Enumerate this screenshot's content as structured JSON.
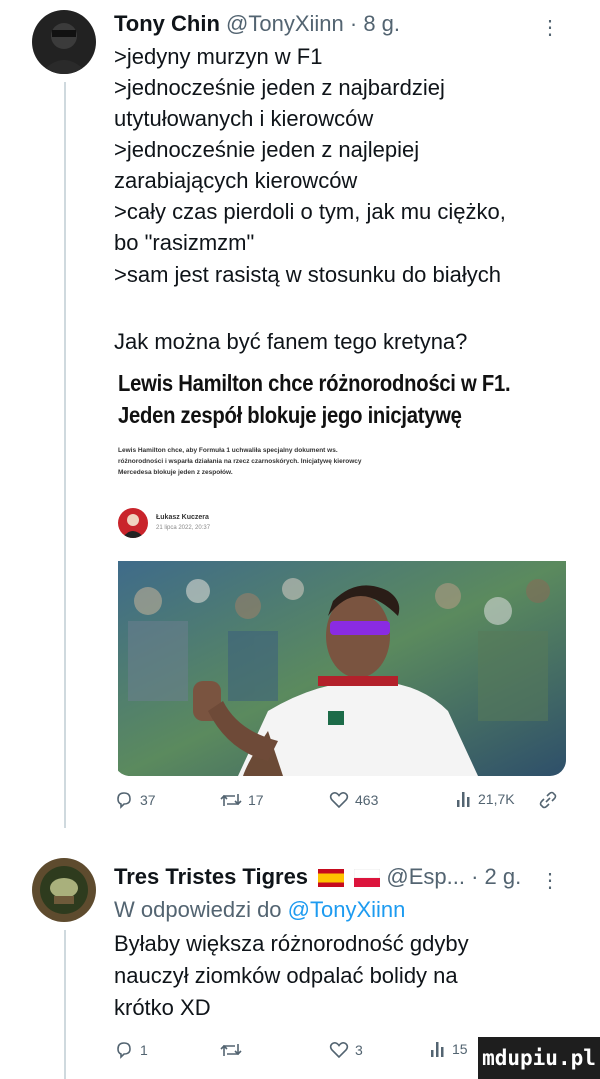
{
  "tweet1": {
    "name": "Tony Chin",
    "handle": "@TonyXiinn · 8 g.",
    "more": "⋮",
    "lines": [
      ">jedyny murzyn w F1",
      ">jednocześnie jeden z najbardziej",
      "utytułowanych i kierowców",
      ">jednocześnie jeden z najlepiej",
      "zarabiających kierowców",
      ">cały czas pierdoli o tym, jak mu ciężko,",
      "bo \"rasizmzm\"",
      ">sam jest rasistą w stosunku do białych",
      "Jak można być fanem tego kretyna?"
    ],
    "card": {
      "title_line1": "Lewis Hamilton chce różnorodności w F1.",
      "title_line2": "Jeden zespół blokuje jego inicjatywę",
      "lead_lines": [
        "Lewis Hamilton chce, aby Formuła 1 uchwaliła specjalny dokument ws.",
        "różnorodności i wsparła działania na rzecz czarnoskórych. Inicjatywę kierowcy",
        "Mercedesa blokuje jeden z zespołów."
      ],
      "author": "Łukasz Kuczera",
      "date": "21 lipca 2022, 20:37"
    },
    "stats": {
      "replies": "37",
      "retweets": "17",
      "likes": "463",
      "views": "21,7K"
    }
  },
  "tweet2": {
    "name": "Tres Tristes Tigres",
    "handle": "@Esp... · 2 g.",
    "more": "⋮",
    "reply_prefix": "W odpowiedzi do",
    "reply_to": "@TonyXiinn",
    "lines": [
      "Byłaby większa różnorodność gdyby",
      "nauczył ziomków odpalać bolidy na",
      "krótko XD"
    ],
    "stats": {
      "replies": "1",
      "likes": "3",
      "views": "15"
    }
  },
  "watermark": "mdupiu.pl",
  "colors": {
    "text": "#0f1419",
    "secondary": "#536471",
    "link": "#1d9bf0",
    "divider": "#cfd9de"
  }
}
